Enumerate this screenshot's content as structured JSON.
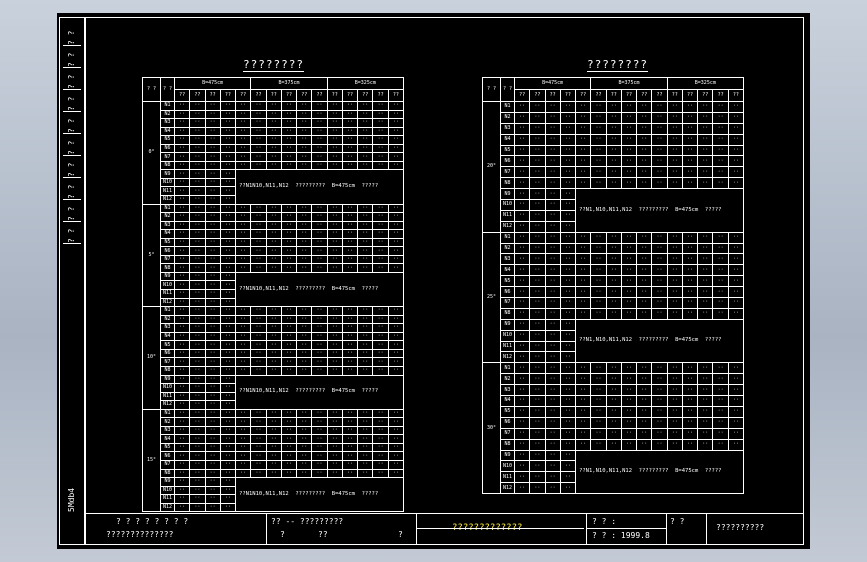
{
  "left_strip": {
    "labels": [
      "? ?",
      "? ?",
      "? ?",
      "? ?",
      "? ?",
      "? ?",
      "? ?",
      "? ?",
      "? ?",
      "? ?"
    ],
    "sheet_code": "5Mdb4"
  },
  "table_left": {
    "title": "????????",
    "header": {
      "corner": "? ?",
      "qm": "? ?",
      "groups": [
        "B=475cm",
        "B=375cm",
        "B=325cm"
      ],
      "sub": [
        "???",
        "? ?",
        "? ?",
        "? ?",
        "? ?",
        "? ? (m)"
      ]
    },
    "rows_per_group": 12,
    "angles": [
      "0°",
      "5°",
      "10°",
      "15°"
    ],
    "note": {
      "a": "??N1N10,N11,N12",
      "b": "?????????",
      "c": "B=475cm",
      "d": "?????"
    }
  },
  "table_right": {
    "title": "????????",
    "header": {
      "corner": "? ?",
      "groups": [
        "B=475cm",
        "B=375cm",
        "B=325cm"
      ]
    },
    "angles": [
      "20°",
      "25°",
      "30°"
    ],
    "note": {
      "a": "??N1,N10,N11,N12",
      "b": "?????????",
      "c": "B=475cm",
      "d": "?????"
    }
  },
  "title_block": {
    "c1a": "? ? ? ? ? ? ? ?",
    "c1b": "??????????????",
    "c2a": "?? -- ?????????",
    "c2b": "?",
    "c2c": "??",
    "c2d": "?",
    "c3": "?????????????",
    "c4a": "? ? :",
    "c4b": "? ? : 1999.8",
    "c5": "?   ?",
    "c6": "??????????"
  },
  "colors": {
    "frame": "#ffffff",
    "background": "#000000",
    "highlight": "#ffef3a"
  }
}
